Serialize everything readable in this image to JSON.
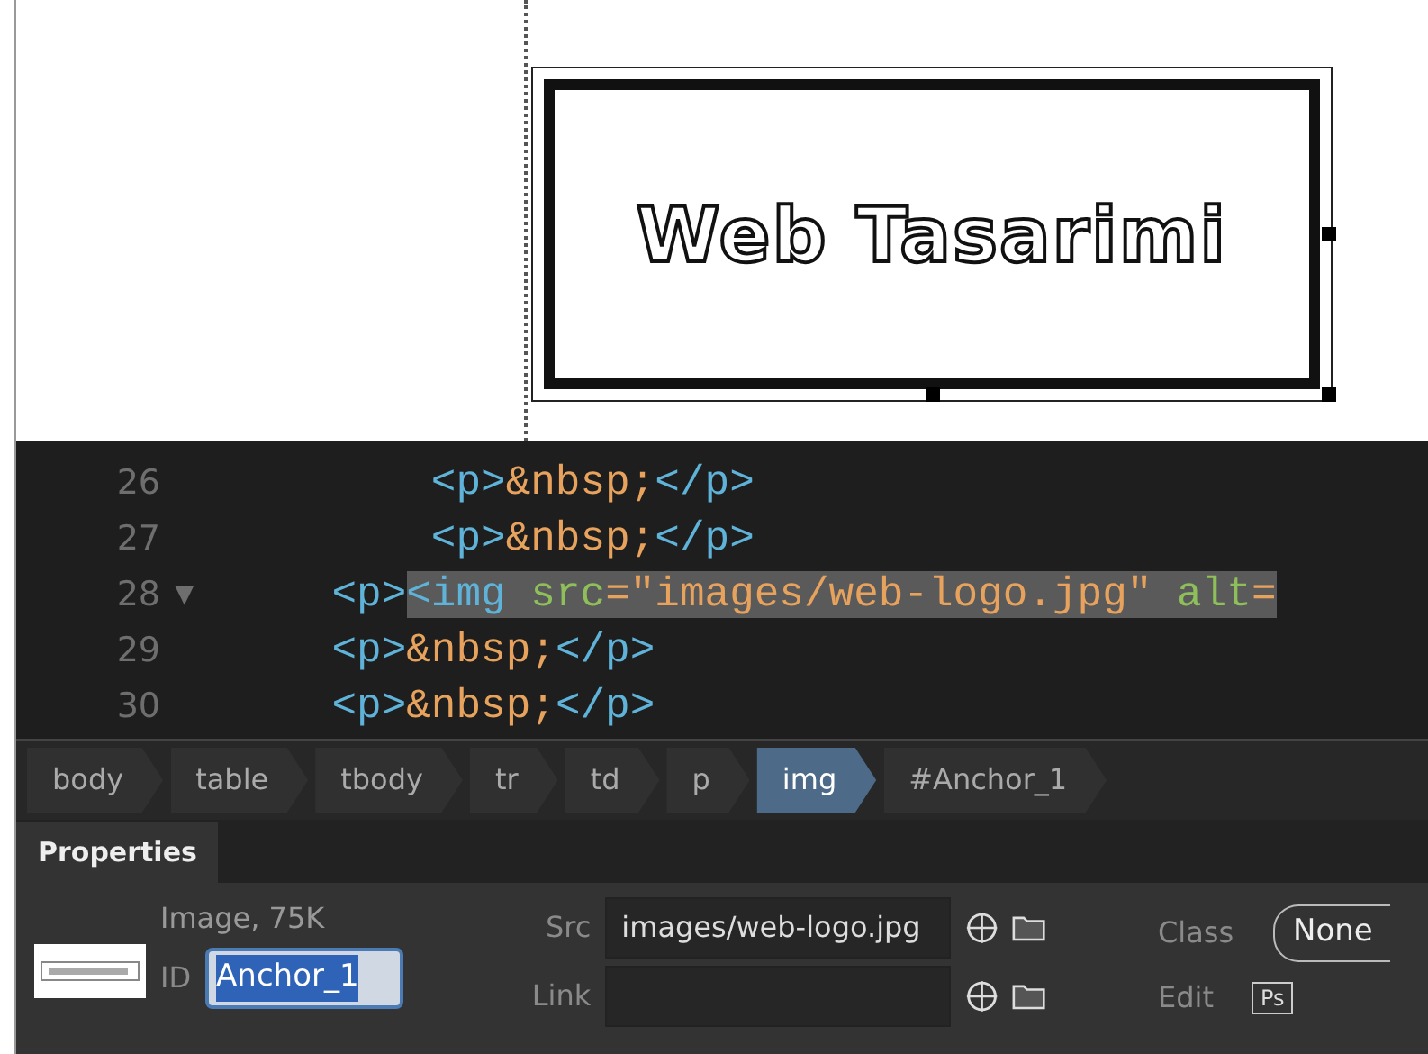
{
  "design_view": {
    "logo_text": "Web Tasarimi"
  },
  "code_lines": [
    {
      "number": "26",
      "segments": [
        {
          "selected": false,
          "tokens": [
            {
              "text": "        <p>",
              "kind": "tag"
            },
            {
              "text": "&nbsp;",
              "kind": "entity"
            },
            {
              "text": "</p>",
              "kind": "tag"
            }
          ]
        }
      ]
    },
    {
      "number": "27",
      "segments": [
        {
          "selected": false,
          "tokens": [
            {
              "text": "        <p>",
              "kind": "tag"
            },
            {
              "text": "&nbsp;",
              "kind": "entity"
            },
            {
              "text": "</p>",
              "kind": "tag"
            }
          ]
        }
      ]
    },
    {
      "number": "28",
      "fold_marker": "▼",
      "segments": [
        {
          "selected": false,
          "tokens": [
            {
              "text": "    <p>",
              "kind": "tag"
            }
          ]
        },
        {
          "selected": true,
          "tokens": [
            {
              "text": "<img",
              "kind": "tag"
            },
            {
              "text": " src",
              "kind": "attr"
            },
            {
              "text": "=\"images/web-logo.jpg\"",
              "kind": "string"
            },
            {
              "text": " alt",
              "kind": "attr"
            },
            {
              "text": "=",
              "kind": "string"
            }
          ]
        }
      ]
    },
    {
      "number": "29",
      "segments": [
        {
          "selected": false,
          "tokens": [
            {
              "text": "    <p>",
              "kind": "tag"
            },
            {
              "text": "&nbsp;",
              "kind": "entity"
            },
            {
              "text": "</p>",
              "kind": "tag"
            }
          ]
        }
      ]
    },
    {
      "number": "30",
      "segments": [
        {
          "selected": false,
          "tokens": [
            {
              "text": "    <p>",
              "kind": "tag"
            },
            {
              "text": "&nbsp;",
              "kind": "entity"
            },
            {
              "text": "</p>",
              "kind": "tag"
            }
          ]
        }
      ]
    }
  ],
  "tag_selector": [
    {
      "label": "body",
      "selected": false
    },
    {
      "label": "table",
      "selected": false
    },
    {
      "label": "tbody",
      "selected": false
    },
    {
      "label": "tr",
      "selected": false
    },
    {
      "label": "td",
      "selected": false
    },
    {
      "label": "p",
      "selected": false
    },
    {
      "label": "img",
      "selected": true
    },
    {
      "label": "#Anchor_1",
      "selected": false
    }
  ],
  "properties": {
    "tab": "Properties",
    "info": "Image, 75K",
    "id_label": "ID",
    "id_value": "Anchor_1",
    "src_label": "Src",
    "src_value": "images/web-logo.jpg",
    "link_label": "Link",
    "class_label": "Class",
    "class_value": "None",
    "edit_label": "Edit",
    "edit_button": "Ps"
  }
}
